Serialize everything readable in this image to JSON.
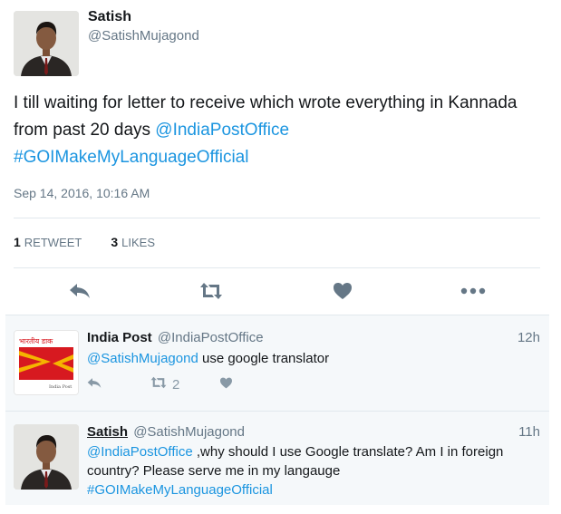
{
  "main_tweet": {
    "name": "Satish",
    "handle": "@SatishMujagond",
    "text_plain": "I till waiting for letter to receive which wrote everything in Kannada from past 20  days ",
    "mention": "@IndiaPostOffice",
    "hashtag": "#GOIMakeMyLanguageOfficial",
    "date": "Sep 14, 2016, 10:16 AM",
    "retweet_count": "1",
    "retweet_label": "RETWEET",
    "like_count": "3",
    "like_label": "LIKES"
  },
  "replies": [
    {
      "name": "India Post",
      "handle": "@IndiaPostOffice",
      "time": "12h",
      "mention": "@SatishMujagond",
      "text": " use google translator",
      "retweet_count": "2",
      "avatar_logo_top": "भारतीय डाक",
      "avatar_logo_bottom": "India Post"
    },
    {
      "name": "Satish",
      "handle": "@SatishMujagond",
      "time": "11h",
      "mention": "@IndiaPostOffice",
      "text_line1": " ,why should I use Google translate? Am I in foreign",
      "text_line2": "country? Please serve me in my langauge",
      "hashtag": "#GOIMakeMyLanguageOfficial"
    }
  ],
  "colors": {
    "link": "#1b95e0",
    "muted": "#657786",
    "icon": "#657786",
    "reply_bg": "#f5f8fa",
    "india_post_red": "#d71920",
    "india_post_yellow": "#f5b400"
  },
  "icons": [
    "reply-icon",
    "retweet-icon",
    "like-icon",
    "more-icon"
  ]
}
